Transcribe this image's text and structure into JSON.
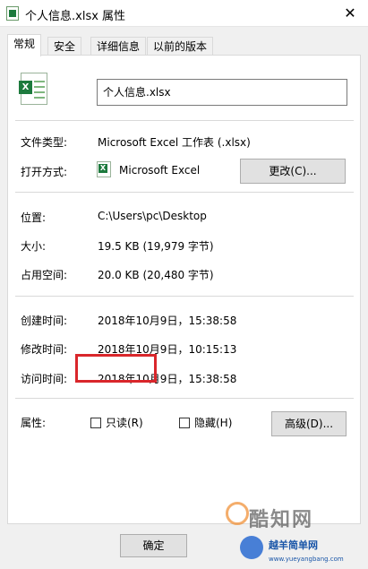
{
  "window": {
    "title": "个人信息.xlsx 属性",
    "close_glyph": "✕"
  },
  "tabs": [
    {
      "label": "常规"
    },
    {
      "label": "安全"
    },
    {
      "label": "详细信息"
    },
    {
      "label": "以前的版本"
    }
  ],
  "general": {
    "file_name": "个人信息.xlsx",
    "file_type_label": "文件类型:",
    "file_type_value": "Microsoft Excel 工作表 (.xlsx)",
    "open_with_label": "打开方式:",
    "open_with_value": "Microsoft Excel",
    "change_button": "更改(C)...",
    "location_label": "位置:",
    "location_value": "C:\\Users\\pc\\Desktop",
    "size_label": "大小:",
    "size_value": "19.5 KB (19,979 字节)",
    "size_on_disk_label": "占用空间:",
    "size_on_disk_value": "20.0 KB (20,480 字节)",
    "created_label": "创建时间:",
    "created_value": "2018年10月9日，15:38:58",
    "modified_label": "修改时间:",
    "modified_value": "2018年10月9日，10:15:13",
    "accessed_label": "访问时间:",
    "accessed_value": "2018年10月9日，15:38:58",
    "attributes_label": "属性:",
    "readonly_label": "只读(R)",
    "readonly_checked": false,
    "hidden_label": "隐藏(H)",
    "hidden_checked": false,
    "advanced_button": "高级(D)..."
  },
  "footer": {
    "ok_button": "确定"
  },
  "watermarks": {
    "primary": "酷知网",
    "secondary": "越羊简单网",
    "secondary_url": "www.yueyangbang.com"
  },
  "colors": {
    "highlight_border": "#d9262b",
    "excel_green": "#1d7a3d"
  },
  "icons": {
    "title_icon": "excel-file-icon",
    "file_icon": "excel-file-icon",
    "open_with_icon": "excel-app-icon",
    "close_icon": "close-icon"
  }
}
